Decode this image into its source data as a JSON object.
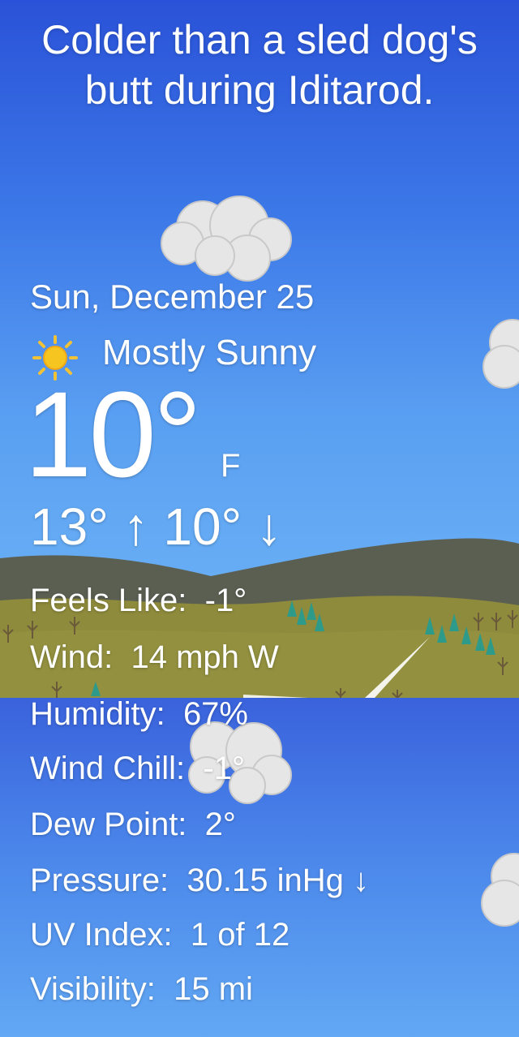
{
  "headline": "Colder than a sled dog's butt during Iditarod.",
  "weather": {
    "date": "Sun, December 25",
    "condition": "Mostly Sunny",
    "condition_icon": "sun-icon",
    "temperature": "10°",
    "unit": "F",
    "hi_lo": "13° ↑ 10° ↓"
  },
  "details": [
    {
      "label": "Feels Like:",
      "value": "-1°"
    },
    {
      "label": "Wind:",
      "value": "14 mph W"
    },
    {
      "label": "Humidity:",
      "value": "67%"
    },
    {
      "label": "Wind Chill:",
      "value": "-1°"
    },
    {
      "label": "Dew Point:",
      "value": "2°"
    },
    {
      "label": "Pressure:",
      "value": "30.15 inHg ↓"
    },
    {
      "label": "UV Index:",
      "value": "1 of 12"
    },
    {
      "label": "Visibility:",
      "value": "15 mi"
    }
  ],
  "colors": {
    "sky_top": "#2a52d8",
    "sky_bottom": "#72b8f6",
    "hill": "#5a5e50",
    "meadow": "#8a8a3a",
    "sun": "#f5c518",
    "text": "#ffffff"
  }
}
